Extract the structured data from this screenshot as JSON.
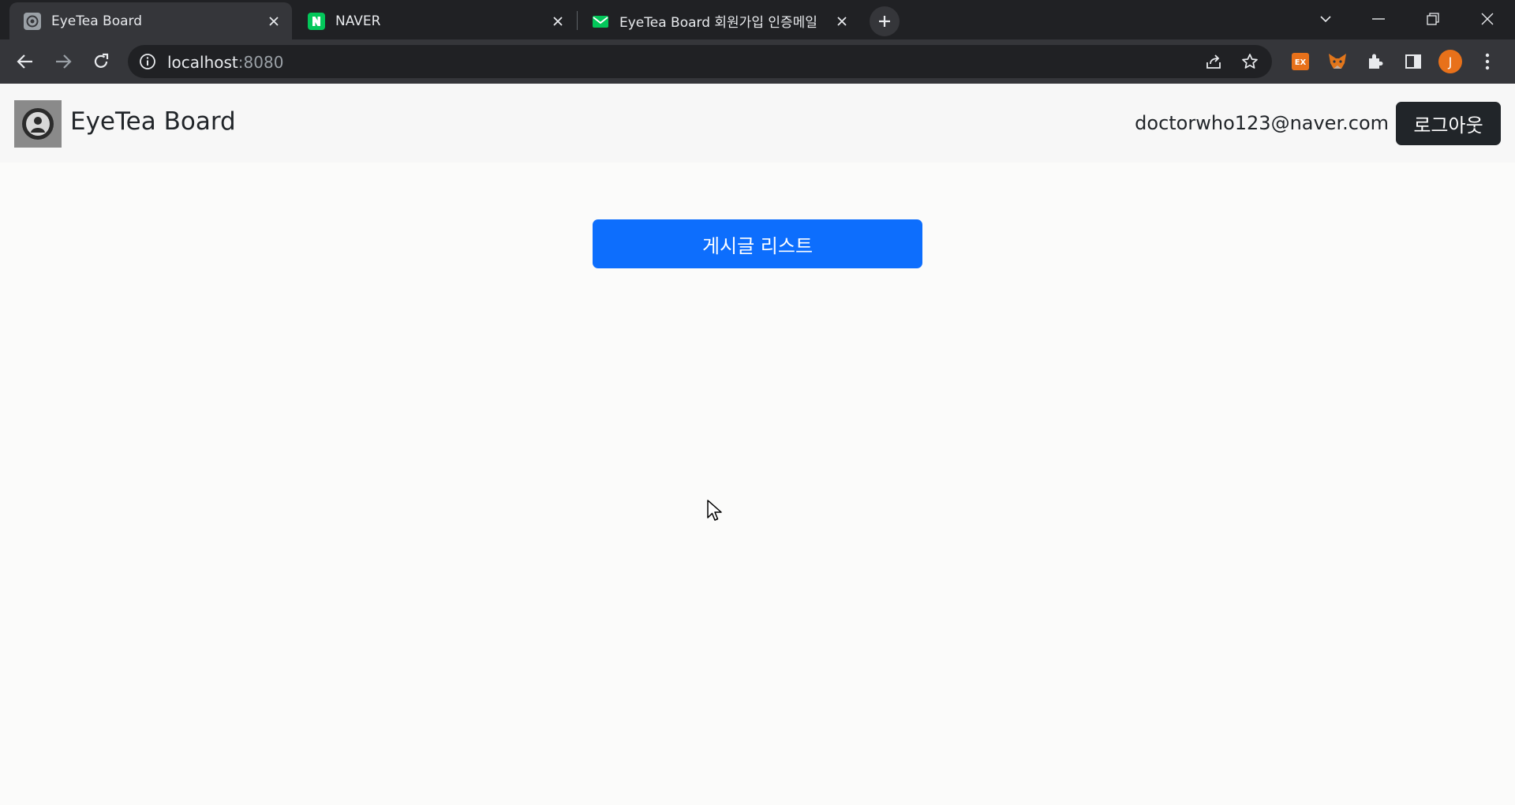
{
  "browser": {
    "tabs": [
      {
        "title": "EyeTea Board",
        "active": true,
        "favicon": "eyetea-favicon"
      },
      {
        "title": "NAVER",
        "active": false,
        "favicon": "naver-favicon"
      },
      {
        "title": "EyeTea Board 회원가입 인증메일",
        "active": false,
        "favicon": "mail-favicon"
      }
    ],
    "url_host": "localhost",
    "url_port": ":8080",
    "extensions": [
      "ex-extension-icon",
      "metamask-fox-icon",
      "puzzle-icon",
      "side-panel-icon"
    ],
    "profile_initial": "J",
    "colors": {
      "tabstrip": "#202124",
      "toolbar": "#35363a",
      "avatar": "#e8711a",
      "naver": "#03c75a"
    }
  },
  "header": {
    "brand": "EyeTea Board",
    "user_email": "doctorwho123@naver.com",
    "logout_label": "로그아웃"
  },
  "main": {
    "list_button_label": "게시글 리스트"
  },
  "colors": {
    "primary": "#0d6efd",
    "dark": "#212529"
  }
}
